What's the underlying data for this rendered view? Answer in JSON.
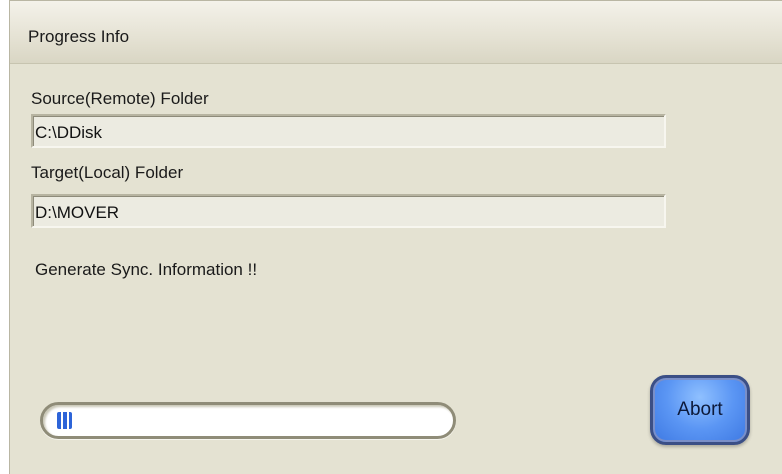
{
  "window": {
    "title": "Progress Info"
  },
  "source": {
    "label": "Source(Remote) Folder",
    "value": "C:\\DDisk"
  },
  "target": {
    "label": "Target(Local) Folder",
    "value": "D:\\MOVER"
  },
  "status": {
    "text": "Generate Sync. Information !!"
  },
  "progress": {
    "fraction": 0.04,
    "color": "#2d64d8"
  },
  "buttons": {
    "abort_label": "Abort"
  }
}
